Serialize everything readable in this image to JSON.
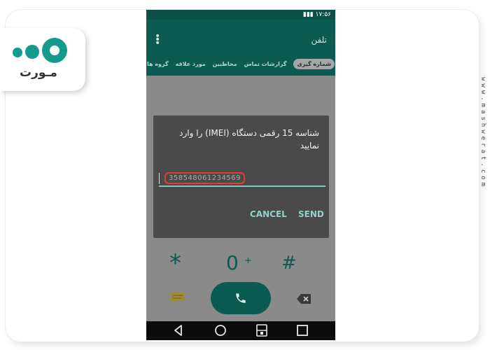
{
  "brand": {
    "logo_text": "مـورت",
    "watermark": "www.mashwerat.com",
    "colors": {
      "brand_teal": "#159a8f",
      "app_bar": "#0b5b53",
      "accent": "#8fd3cb",
      "highlight_red": "#e43a3a"
    }
  },
  "status_bar": {
    "time": "۱۷:۵۶"
  },
  "app": {
    "title": "تلفن",
    "tabs": [
      "شماره گیری",
      "گزارشات تماس",
      "مخاطبین",
      "مورد علاقه",
      "گروه ها"
    ],
    "active_tab_index": 0
  },
  "dialog": {
    "message": "شناسه 15 رقمی دستگاه (IMEI) را وارد نمایید",
    "input_value": "358548061234569",
    "cancel_label": "CANCEL",
    "send_label": "SEND"
  },
  "dialpad": {
    "star_key": "*",
    "zero_key": "0",
    "zero_secondary": "+",
    "hash_key": "#"
  },
  "icons": {
    "message": "message-icon",
    "call": "phone-icon",
    "backspace": "backspace-icon",
    "nav_back": "back-icon",
    "nav_home": "home-icon",
    "nav_sim": "sim-switch-icon",
    "nav_recent": "recent-apps-icon"
  }
}
